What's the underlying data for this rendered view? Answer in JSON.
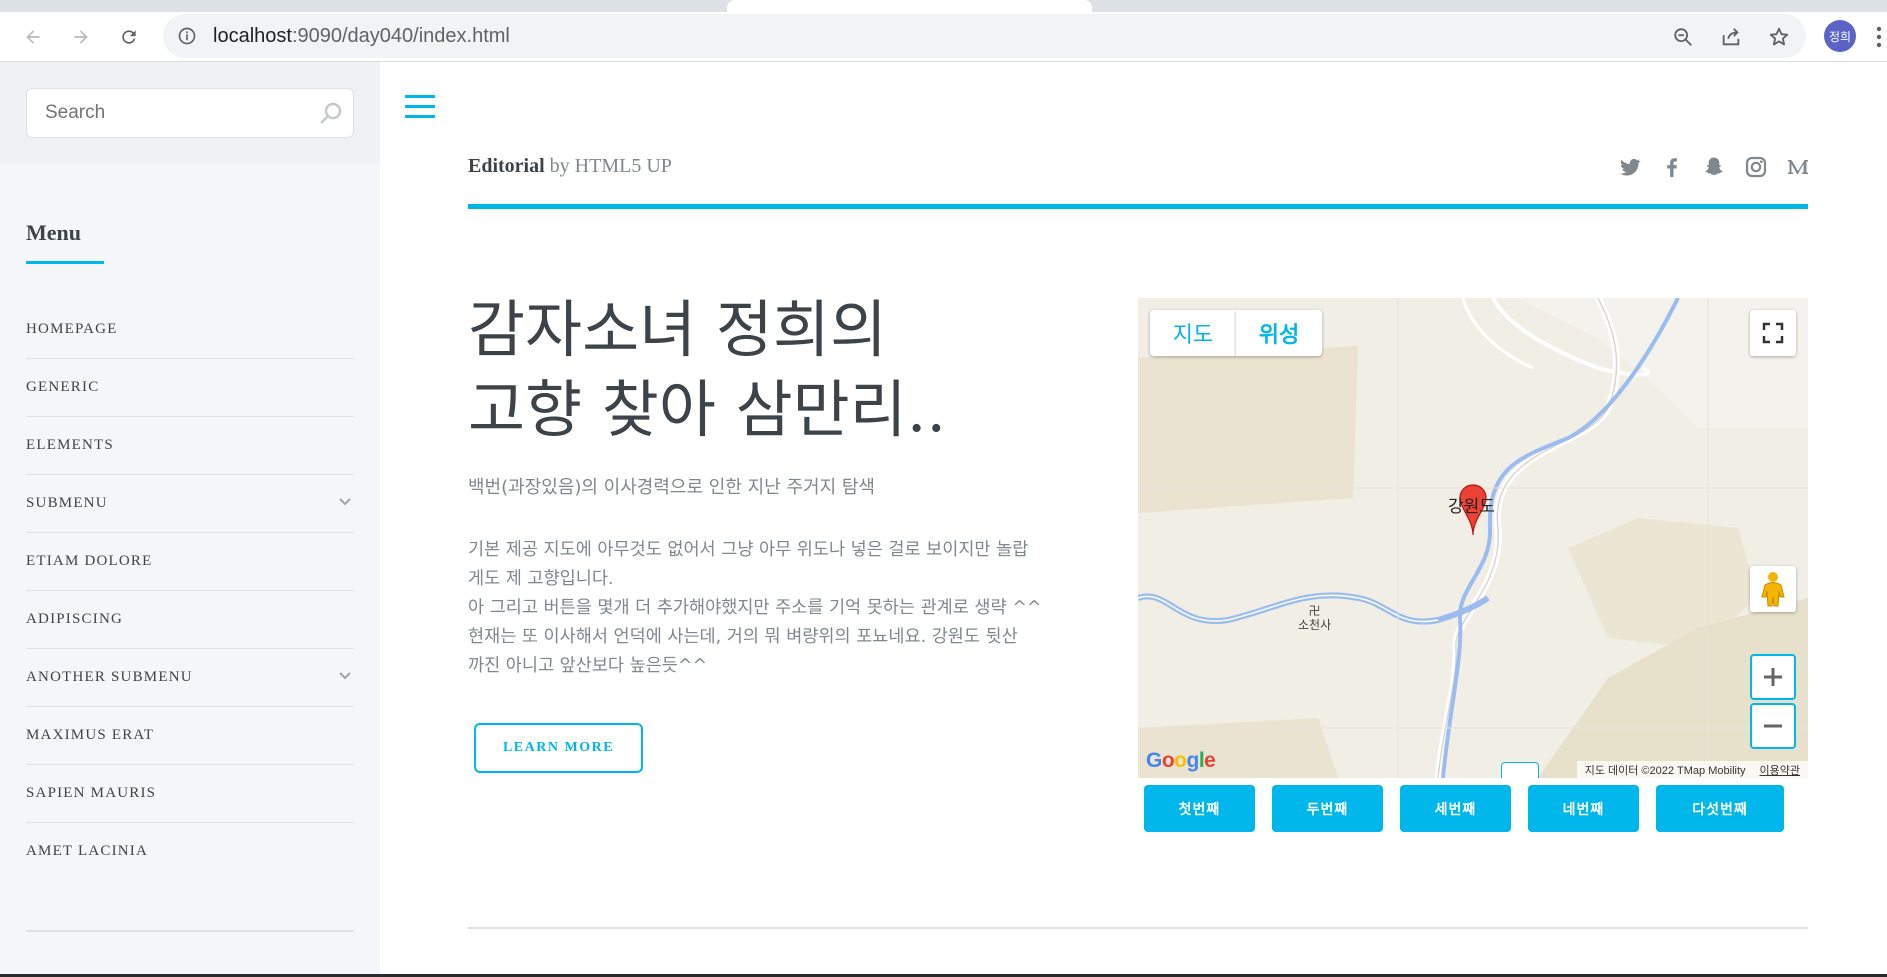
{
  "browser": {
    "url_host": "localhost",
    "url_rest": ":9090/day040/index.html",
    "profile_initials": "정희"
  },
  "sidebar": {
    "search_placeholder": "Search",
    "menu_title": "Menu",
    "items": [
      {
        "label": "HOMEPAGE",
        "has_submenu": false
      },
      {
        "label": "GENERIC",
        "has_submenu": false
      },
      {
        "label": "ELEMENTS",
        "has_submenu": false
      },
      {
        "label": "SUBMENU",
        "has_submenu": true
      },
      {
        "label": "ETIAM DOLORE",
        "has_submenu": false
      },
      {
        "label": "ADIPISCING",
        "has_submenu": false
      },
      {
        "label": "ANOTHER SUBMENU",
        "has_submenu": true
      },
      {
        "label": "MAXIMUS ERAT",
        "has_submenu": false
      },
      {
        "label": "SAPIEN MAURIS",
        "has_submenu": false
      },
      {
        "label": "AMET LACINIA",
        "has_submenu": false
      }
    ]
  },
  "header": {
    "logo_bold": "Editorial",
    "logo_rest": " by HTML5 UP",
    "social_icons": [
      "twitter-icon",
      "facebook-icon",
      "snapchat-icon",
      "instagram-icon",
      "medium-icon"
    ]
  },
  "main": {
    "headline_line1": "감자소녀 정희의",
    "headline_line2": "고향 찾아 삼만리..",
    "subtitle": "백번(과장있음)의 이사경력으로 인한 지난 주거지 탐색",
    "body_lines": [
      "기본 제공 지도에 아무것도 없어서 그냥 아무 위도나 넣은 걸로 보이지만 놀랍",
      "게도 제 고향입니다.",
      "아 그리고 버튼을 몇개 더 추가해야했지만 주소를 기억 못하는 관계로 생략 ^^",
      "현재는 또 이사해서 언덕에 사는데, 거의 뭐 벼량위의 포뇨네요. 강원도 뒷산",
      "까진 아니고 앞산보다 높은듯^^"
    ],
    "learn_more": "LEARN MORE"
  },
  "map": {
    "type_map": "지도",
    "type_satellite": "위성",
    "marker_label": "강원도",
    "place_label": "소천사",
    "google": "Google",
    "attribution": "지도 데이터 ©2022 TMap Mobility",
    "terms": "이용약관"
  },
  "location_buttons": [
    "첫번째",
    "두번째",
    "세번째",
    "네번째",
    "다섯번째"
  ],
  "colors": {
    "accent": "#00b7ec",
    "text": "#3d4449",
    "muted": "#7f888f",
    "sidebar_bg": "#f5f6f7",
    "marker": "#ea4335"
  }
}
